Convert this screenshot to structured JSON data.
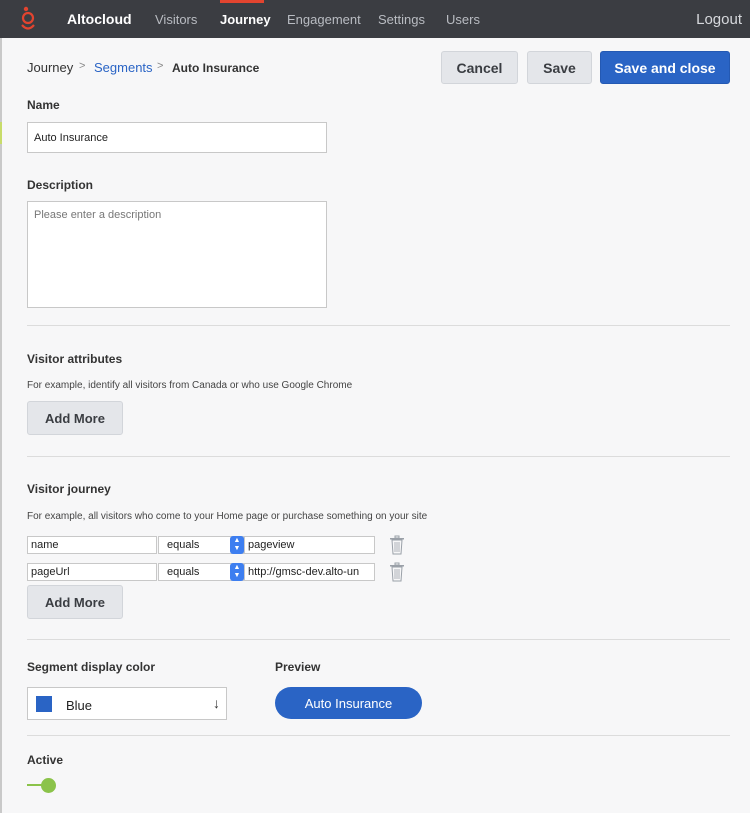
{
  "nav": {
    "brand": "Altocloud",
    "items": [
      {
        "label": "Visitors",
        "active": false
      },
      {
        "label": "Journey",
        "active": true
      },
      {
        "label": "Engagement",
        "active": false
      },
      {
        "label": "Settings",
        "active": false
      },
      {
        "label": "Users",
        "active": false
      }
    ],
    "logout": "Logout",
    "accent_color": "#e2442f"
  },
  "breadcrumb": {
    "root": "Journey",
    "parent": "Segments",
    "current": "Auto Insurance",
    "separator": ">"
  },
  "actions": {
    "cancel": "Cancel",
    "save": "Save",
    "save_close": "Save and close"
  },
  "form": {
    "name_label": "Name",
    "name_value": "Auto Insurance",
    "description_label": "Description",
    "description_placeholder": "Please enter a description",
    "visitor_attributes": {
      "title": "Visitor attributes",
      "hint": "For example, identify all visitors from Canada or who use Google Chrome",
      "add_more": "Add More"
    },
    "visitor_journey": {
      "title": "Visitor journey",
      "hint": "For example, all visitors who come to your Home page or purchase something on your site",
      "rules": [
        {
          "field": "name",
          "operator": "equals",
          "value": "pageview"
        },
        {
          "field": "pageUrl",
          "operator": "equals",
          "value": "http://gmsc-dev.alto-un"
        }
      ],
      "add_more": "Add More"
    },
    "color": {
      "label": "Segment display color",
      "value": "Blue",
      "swatch": "#2a64c5",
      "arrow": "↓"
    },
    "preview": {
      "label": "Preview",
      "pill_text": "Auto Insurance"
    },
    "active": {
      "label": "Active",
      "on": true,
      "color": "#8bc34a"
    }
  }
}
